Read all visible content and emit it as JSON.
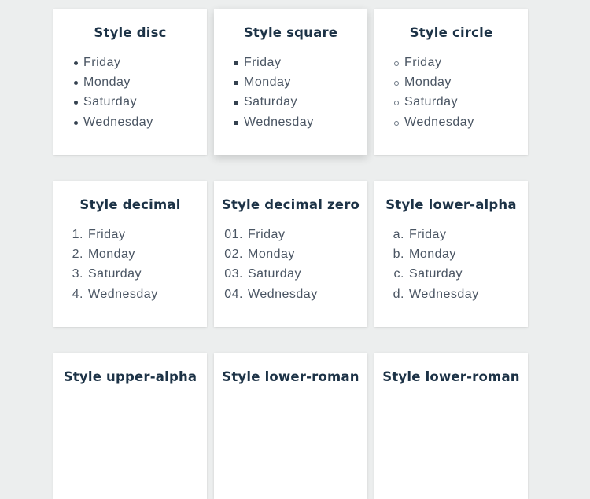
{
  "cards": [
    {
      "title": "Style disc",
      "style": "disc",
      "items": [
        {
          "marker": "",
          "label": "Friday"
        },
        {
          "marker": "",
          "label": "Monday"
        },
        {
          "marker": "",
          "label": "Saturday"
        },
        {
          "marker": "",
          "label": "Wednesday"
        }
      ]
    },
    {
      "title": "Style square",
      "style": "square",
      "items": [
        {
          "marker": "",
          "label": "Friday"
        },
        {
          "marker": "",
          "label": "Monday"
        },
        {
          "marker": "",
          "label": "Saturday"
        },
        {
          "marker": "",
          "label": "Wednesday"
        }
      ]
    },
    {
      "title": "Style circle",
      "style": "circle",
      "items": [
        {
          "marker": "",
          "label": "Friday"
        },
        {
          "marker": "",
          "label": "Monday"
        },
        {
          "marker": "",
          "label": "Saturday"
        },
        {
          "marker": "",
          "label": "Wednesday"
        }
      ]
    },
    {
      "title": "Style decimal",
      "style": "decimal",
      "items": [
        {
          "marker": "1.",
          "label": "Friday"
        },
        {
          "marker": "2.",
          "label": "Monday"
        },
        {
          "marker": "3.",
          "label": "Saturday"
        },
        {
          "marker": "4.",
          "label": "Wednesday"
        }
      ]
    },
    {
      "title": "Style decimal zero",
      "style": "decimal-leading-zero",
      "items": [
        {
          "marker": "01.",
          "label": "Friday"
        },
        {
          "marker": "02.",
          "label": "Monday"
        },
        {
          "marker": "03.",
          "label": "Saturday"
        },
        {
          "marker": "04.",
          "label": "Wednesday"
        }
      ]
    },
    {
      "title": "Style lower-alpha",
      "style": "lower-alpha",
      "items": [
        {
          "marker": "a.",
          "label": "Friday"
        },
        {
          "marker": "b.",
          "label": "Monday"
        },
        {
          "marker": "c.",
          "label": "Saturday"
        },
        {
          "marker": "d.",
          "label": "Wednesday"
        }
      ]
    },
    {
      "title": "Style upper-alpha",
      "style": "upper-alpha",
      "items": []
    },
    {
      "title": "Style lower-roman",
      "style": "lower-roman",
      "items": []
    },
    {
      "title": "Style lower-roman",
      "style": "lower-roman",
      "items": []
    }
  ]
}
